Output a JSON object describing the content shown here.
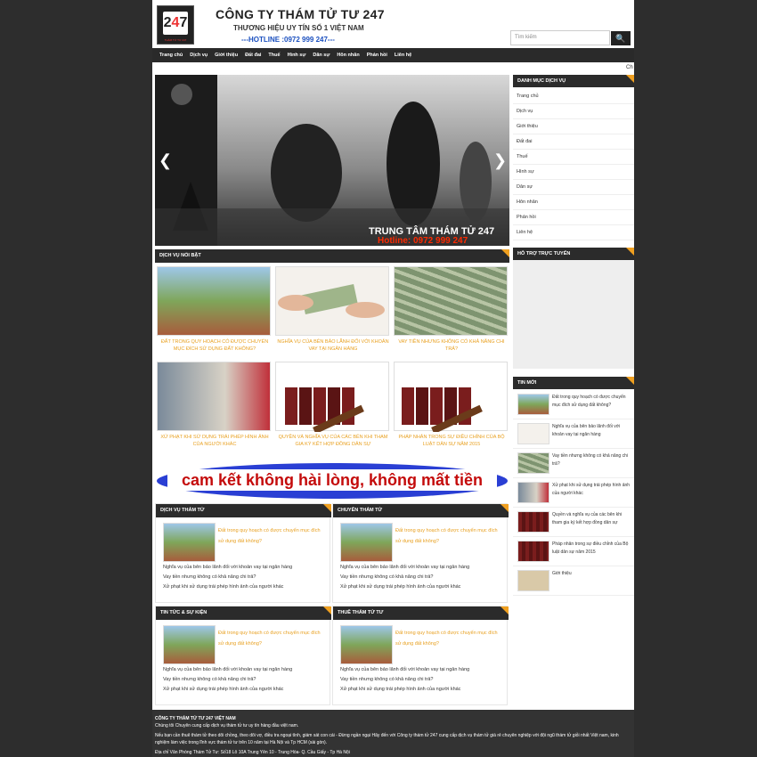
{
  "header": {
    "title": "CÔNG TY THÁM TỬ TƯ 247",
    "subtitle": "THƯƠNG HIỆU UY TÍN SỐ 1 VIỆT NAM",
    "hotline": "---HOTLINE :0972 999 247---",
    "logo_caption": "THÁM TỬ TƯ 247",
    "search_placeholder": "Tìm kiếm",
    "search_icon": "search-icon"
  },
  "nav": [
    "Trang chủ",
    "Dịch vụ",
    "Giới thiệu",
    "Đất đai",
    "Thuế",
    "Hình sự",
    "Dân sự",
    "Hôn nhân",
    "Phản hồi",
    "Liên hệ"
  ],
  "ticker": "Ch",
  "slider": {
    "caption1": "TRUNG TÂM THÁM TỬ 247",
    "caption2": "Hotline: 0972 999 247"
  },
  "featured": {
    "title": "DỊCH VỤ NỔI BẬT",
    "items": [
      "ĐẤT TRONG QUY HOẠCH CÓ ĐƯỢC CHUYỂN MỤC ĐÍCH SỬ DỤNG ĐẤT KHÔNG?",
      "NGHĨA VỤ CỦA BÊN BẢO LÃNH ĐỐI VỚI KHOẢN VAY TẠI NGÂN HÀNG",
      "VAY TIỀN NHƯNG KHÔNG CÓ KHẢ NĂNG CHI TRẢ?",
      "XỬ PHẠT KHI SỬ DỤNG TRÁI PHÉP HÌNH ẢNH CỦA NGƯỜI KHÁC",
      "QUYỀN VÀ NGHĨA VỤ CỦA CÁC BÊN KHI THAM GIA KÝ KẾT HỢP ĐỒNG DÂN SỰ",
      "PHÁP NHÂN TRONG SỰ ĐIỀU CHỈNH CỦA BỘ LUẬT DÂN SỰ NĂM 2015"
    ]
  },
  "banner": "cam kết không hài lòng, không mất tiền",
  "boxes": [
    {
      "title": "DỊCH VỤ THÁM TỬ",
      "lead": "Đất trong quy hoạch có được chuyển mục đích sử dụng đất không?",
      "items": [
        "Nghĩa vụ của bên bảo lãnh đối với khoản vay tại ngân hàng",
        "Vay tiền nhưng không có khả năng chi trả?",
        "Xử phạt khi sử dụng trái phép hình ảnh của người khác"
      ]
    },
    {
      "title": "CHUYÊN THÁM TỬ",
      "lead": "Đất trong quy hoạch có được chuyển mục đích sử dụng đất không?",
      "items": [
        "Nghĩa vụ của bên bảo lãnh đối với khoản vay tại ngân hàng",
        "Vay tiền nhưng không có khả năng chi trả?",
        "Xử phạt khi sử dụng trái phép hình ảnh của người khác"
      ]
    },
    {
      "title": "TIN TỨC & SỰ KIỆN",
      "lead": "Đất trong quy hoạch có được chuyển mục đích sử dụng đất không?",
      "items": [
        "Nghĩa vụ của bên bảo lãnh đối với khoản vay tại ngân hàng",
        "Vay tiền nhưng không có khả năng chi trả?",
        "Xử phạt khi sử dụng trái phép hình ảnh của người khác"
      ]
    },
    {
      "title": "THUÊ THÁM TỬ TƯ",
      "lead": "Đất trong quy hoạch có được chuyển mục đích sử dụng đất không?",
      "items": [
        "Nghĩa vụ của bên bảo lãnh đối với khoản vay tại ngân hàng",
        "Vay tiền nhưng không có khả năng chi trả?",
        "Xử phạt khi sử dụng trái phép hình ảnh của người khác"
      ]
    }
  ],
  "sidebar": {
    "menu_title": "DANH MỤC DỊCH VỤ",
    "menu": [
      "Trang chủ",
      "Dịch vụ",
      "Giới thiệu",
      "Đất đai",
      "Thuế",
      "Hình sự",
      "Dân sự",
      "Hôn nhân",
      "Phản hồi",
      "Liên hệ"
    ],
    "support_title": "HỖ TRỢ TRỰC TUYẾN",
    "news_title": "TIN MỚI",
    "news": [
      "Đất trong quy hoạch có được chuyển mục đích sử dụng đất không?",
      "Nghĩa vụ của bên bảo lãnh đối với khoản vay tại ngân hàng",
      "Vay tiền nhưng không có khả năng chi trả?",
      "Xử phạt khi sử dụng trái phép hình ảnh của người khác",
      "Quyền và nghĩa vụ của các bên khi tham gia ký kết hợp đồng dân sự",
      "Pháp nhân trong sự điều chỉnh của Bộ luật dân sự năm 2015",
      "Giới thiệu"
    ]
  },
  "footer": {
    "company": "CÔNG TY THÁM TỬ TƯ 247 VIỆT NAM",
    "line1": "Chúng tôi Chuyên cung cấp dịch vụ thám tử tư uy tín hàng đầu việt nam.",
    "line2": "Nếu bạn cần thuê thám tử theo dõi chồng, theo dõi vợ, điều tra ngoại tình, giám sát con cái - Đừng ngần ngại Hãy đến với Công ty thám tử 247 cung cấp dịch vụ thám tử giá rẻ chuyên nghiệp với đội ngũ thám tử giỏi nhất Việt nam, kinh nghiệm làm việc trong lĩnh vực thám tử tư trên 10 năm tại Hà Nội và Tp HCM (sài gòn).",
    "line3": "Địa chỉ Văn Phòng Thám Tử Tư: Số18 Lô 10A Trung Yên 10 - Trung Hòa- Q. Cầu Giấy - Tp Hà Nội"
  }
}
